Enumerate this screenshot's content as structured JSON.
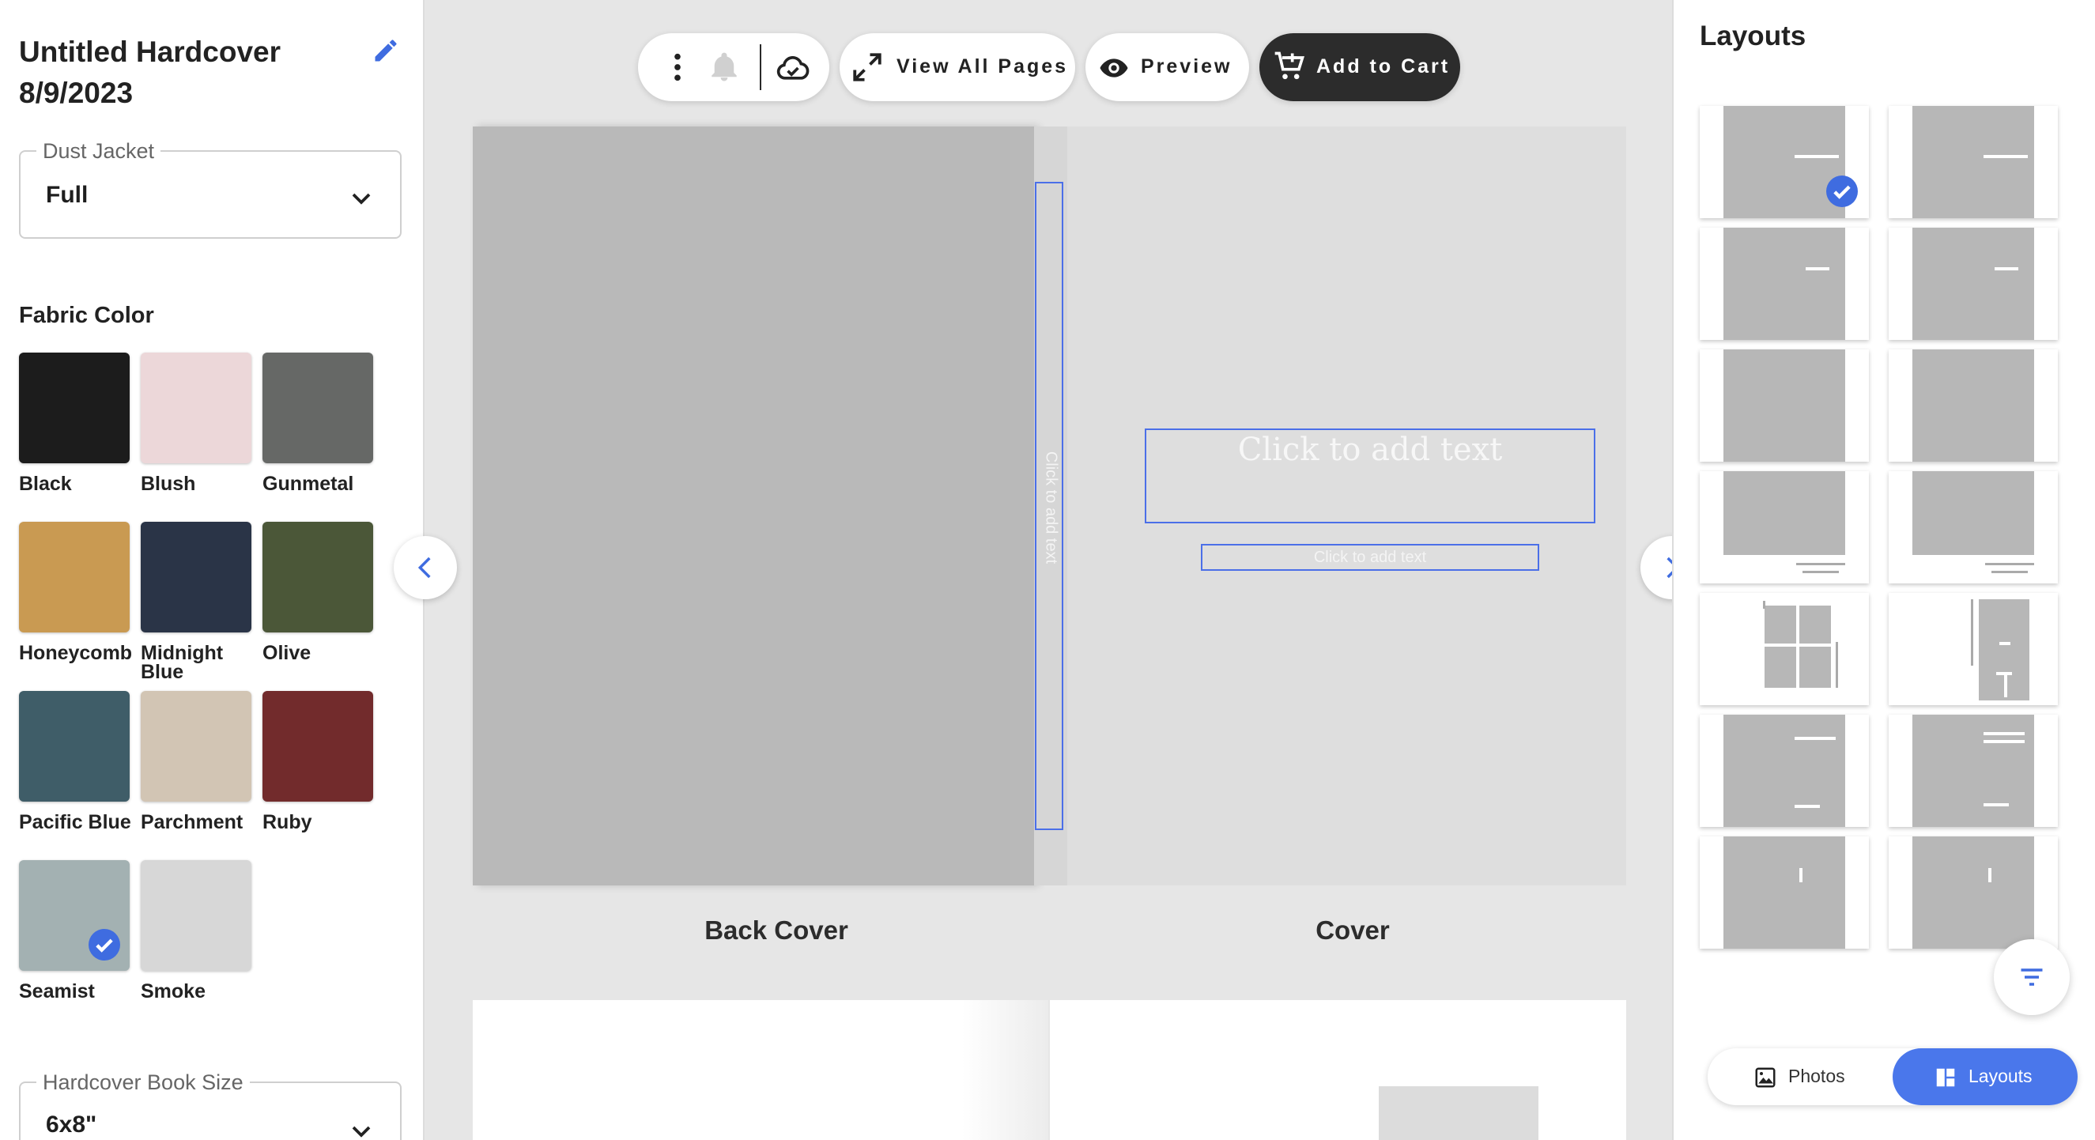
{
  "project": {
    "title_line1": "Untitled Hardcover",
    "title_line2": "8/9/2023"
  },
  "dust_jacket": {
    "label": "Dust Jacket",
    "value": "Full"
  },
  "fabric": {
    "title": "Fabric Color",
    "selected": "Seamist",
    "colors": [
      {
        "name": "Black",
        "hex": "#1c1c1c"
      },
      {
        "name": "Blush",
        "hex": "#ecd7d9"
      },
      {
        "name": "Gunmetal",
        "hex": "#666866"
      },
      {
        "name": "Honeycomb",
        "hex": "#c99a52"
      },
      {
        "name": "Midnight Blue",
        "hex": "#2a3447"
      },
      {
        "name": "Olive",
        "hex": "#4b5738"
      },
      {
        "name": "Pacific Blue",
        "hex": "#3f5d68"
      },
      {
        "name": "Parchment",
        "hex": "#d2c5b4"
      },
      {
        "name": "Ruby",
        "hex": "#722b2c"
      },
      {
        "name": "Seamist",
        "hex": "#a3b1b2"
      },
      {
        "name": "Smoke",
        "hex": "#d7d7d7"
      }
    ]
  },
  "book_size": {
    "label": "Hardcover Book Size",
    "value": "6x8\""
  },
  "toolbar": {
    "view_all_label": "View All Pages",
    "preview_label": "Preview",
    "cart_label": "Add to Cart"
  },
  "canvas": {
    "spine_placeholder": "Click to add text",
    "title_placeholder": "Click to add text",
    "subtitle_placeholder": "Click to add text",
    "back_cover_label": "Back Cover",
    "cover_label": "Cover"
  },
  "right_panel": {
    "title": "Layouts",
    "selected_layout": 0,
    "layout_count": 14
  },
  "tabs": {
    "photos_label": "Photos",
    "layouts_label": "Layouts",
    "active": "layouts"
  },
  "colors": {
    "accent": "#4a77eb",
    "selection_outline": "#4b6fe8",
    "dark_button": "#2c2c2c"
  }
}
